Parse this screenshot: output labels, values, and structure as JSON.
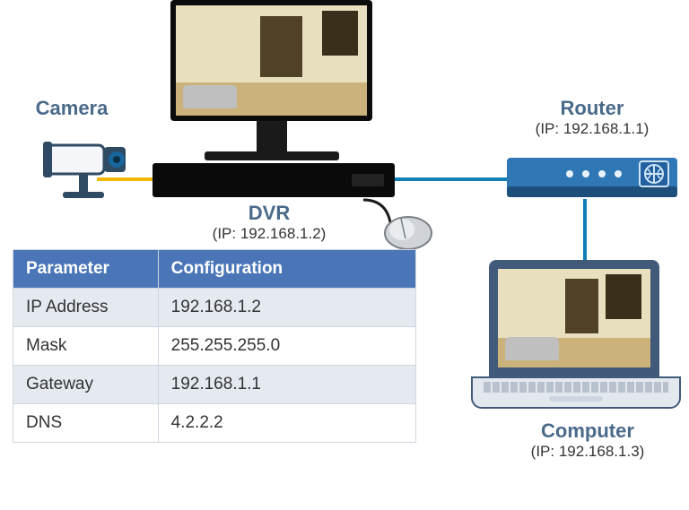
{
  "camera": {
    "label": "Camera"
  },
  "dvr": {
    "label": "DVR",
    "ip_line": "(IP:  192.168.1.2)"
  },
  "router": {
    "label": "Router",
    "ip_line": "(IP:  192.168.1.1)"
  },
  "computer": {
    "label": "Computer",
    "ip_line": "(IP:  192.168.1.3)"
  },
  "table": {
    "headers": [
      "Parameter",
      "Configuration"
    ],
    "rows": [
      {
        "param": "IP Address",
        "value": "192.168.1.2"
      },
      {
        "param": "Mask",
        "value": "255.255.255.0"
      },
      {
        "param": "Gateway",
        "value": "192.168.1.1"
      },
      {
        "param": "DNS",
        "value": "4.2.2.2"
      }
    ]
  },
  "colors": {
    "label_blue": "#4a6a8a",
    "table_header": "#4a76b8",
    "cable_blue": "#0f7fb5",
    "cable_yellow": "#f2b705"
  }
}
